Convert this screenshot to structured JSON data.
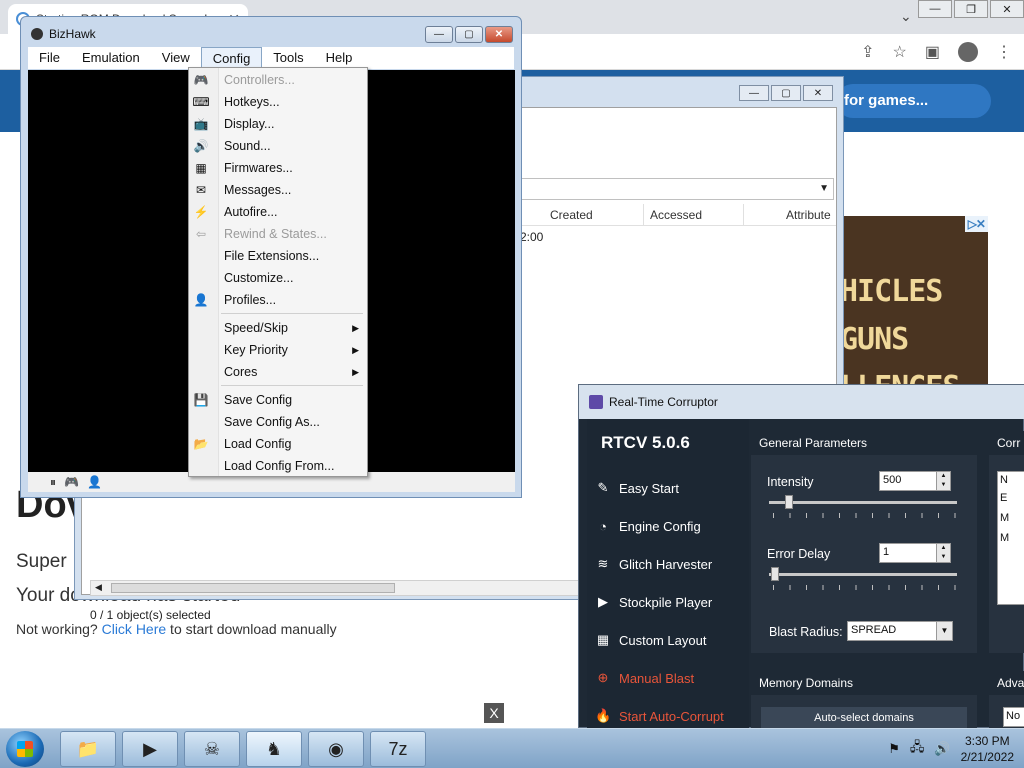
{
  "chrome": {
    "tab_title": "Starting ROM Download Super I",
    "site_search": "for games...",
    "ad_text_1": "HICLES",
    "ad_text_2": "GUNS",
    "ad_text_3": "LLENGES",
    "ad_badge": "▷✕",
    "heading": "Dov",
    "line1": "Super",
    "line2": "Your download has started",
    "line3_prefix": "Not working? ",
    "line3_link": "Click Here",
    "line3_suffix": " to start download manually",
    "close_x": "X"
  },
  "explorer": {
    "columns": [
      "Created",
      "Accessed",
      "Attribute"
    ],
    "time_fragment": "2:00",
    "status": "0 / 1 object(s) selected"
  },
  "bizhawk": {
    "title": "BizHawk",
    "menu": [
      "File",
      "Emulation",
      "View",
      "Config",
      "Tools",
      "Help"
    ],
    "config_menu": {
      "items": [
        {
          "label": "Controllers...",
          "icon": "gamepad-icon",
          "glyph": "🎮",
          "disabled": true
        },
        {
          "label": "Hotkeys...",
          "icon": "keyboard-icon",
          "glyph": "⌨",
          "disabled": false
        },
        {
          "label": "Display...",
          "icon": "monitor-icon",
          "glyph": "📺",
          "disabled": false
        },
        {
          "label": "Sound...",
          "icon": "speaker-icon",
          "glyph": "🔊",
          "disabled": false
        },
        {
          "label": "Firmwares...",
          "icon": "chip-icon",
          "glyph": "▦",
          "disabled": false
        },
        {
          "label": "Messages...",
          "icon": "message-icon",
          "glyph": "✉",
          "disabled": false
        },
        {
          "label": "Autofire...",
          "icon": "lightning-icon",
          "glyph": "⚡",
          "disabled": false
        },
        {
          "label": "Rewind & States...",
          "icon": "rewind-icon",
          "glyph": "⇦",
          "disabled": true
        },
        {
          "label": "File Extensions...",
          "icon": "",
          "glyph": "",
          "disabled": false
        },
        {
          "label": "Customize...",
          "icon": "",
          "glyph": "",
          "disabled": false
        },
        {
          "label": "Profiles...",
          "icon": "user-icon",
          "glyph": "👤",
          "disabled": false
        }
      ],
      "submenus": [
        "Speed/Skip",
        "Key Priority",
        "Cores"
      ],
      "config_items": [
        {
          "label": "Save Config",
          "icon": "save-icon",
          "glyph": "💾"
        },
        {
          "label": "Save Config As...",
          "icon": "",
          "glyph": ""
        },
        {
          "label": "Load Config",
          "icon": "load-icon",
          "glyph": "📂"
        },
        {
          "label": "Load Config From...",
          "icon": "",
          "glyph": ""
        }
      ]
    },
    "status_icons": [
      "pause-icon",
      "controller-status-icon",
      "user-status-icon"
    ]
  },
  "rtcv": {
    "title": "Real-Time Corruptor",
    "version": "RTCV 5.0.6",
    "nav": [
      {
        "label": "Easy Start",
        "icon": "wand-icon",
        "glyph": "✎",
        "red": false
      },
      {
        "label": "Engine Config",
        "icon": "gauge-icon",
        "glyph": "◔",
        "red": false
      },
      {
        "label": "Glitch Harvester",
        "icon": "layers-icon",
        "glyph": "≋",
        "red": false
      },
      {
        "label": "Stockpile Player",
        "icon": "play-icon",
        "glyph": "▶",
        "red": false
      },
      {
        "label": "Custom Layout",
        "icon": "grid-icon",
        "glyph": "▦",
        "red": false
      },
      {
        "label": "Manual Blast",
        "icon": "crosshair-icon",
        "glyph": "⊕",
        "red": true
      },
      {
        "label": "Start Auto-Corrupt",
        "icon": "flame-icon",
        "glyph": "🔥",
        "red": true
      }
    ],
    "general": {
      "header": "General Parameters",
      "intensity_label": "Intensity",
      "intensity_value": "500",
      "error_delay_label": "Error Delay",
      "error_delay_value": "1",
      "blast_radius_label": "Blast Radius:",
      "blast_radius_value": "SPREAD"
    },
    "memory": {
      "header": "Memory Domains",
      "auto_select": "Auto-select domains"
    },
    "right_header_1": "Corr",
    "right_box_1": "N",
    "right_box_1_rows": [
      "E",
      "M",
      "M"
    ],
    "right_header_2": "Adva",
    "right_box_2": "No"
  },
  "taskbar": {
    "apps": [
      {
        "name": "taskbar-explorer",
        "glyph": "📁"
      },
      {
        "name": "taskbar-media",
        "glyph": "▶"
      },
      {
        "name": "taskbar-rtcv",
        "glyph": "☠"
      },
      {
        "name": "taskbar-bizhawk",
        "glyph": "♞"
      },
      {
        "name": "taskbar-chrome",
        "glyph": "◉"
      },
      {
        "name": "taskbar-7zip",
        "glyph": "7z"
      }
    ],
    "time": "3:30 PM",
    "date": "2/21/2022"
  }
}
